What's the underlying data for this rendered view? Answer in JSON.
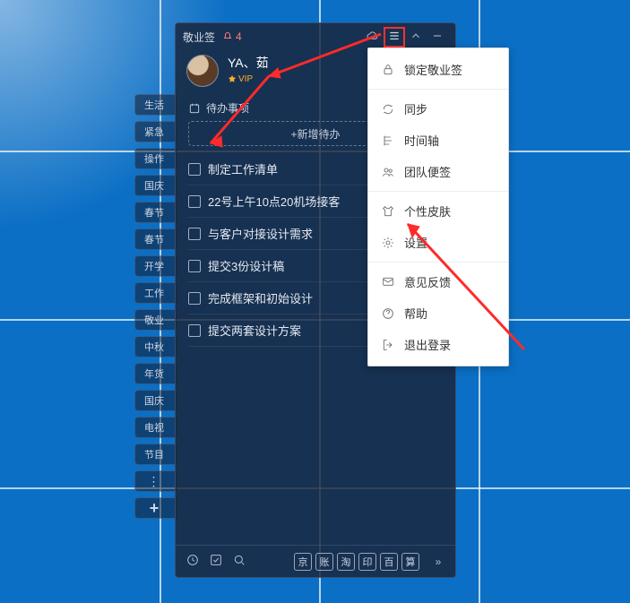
{
  "app_name": "敬业签",
  "notification_count": "4",
  "user": {
    "name": "YA、茹",
    "vip_label": "VIP"
  },
  "section_title": "待办事项",
  "add_button": "+新增待办",
  "todos": [
    "制定工作清单",
    "22号上午10点20机场接客",
    "与客户对接设计需求",
    "提交3份设计稿",
    "完成框架和初始设计",
    "提交两套设计方案"
  ],
  "side_tags": [
    "生活",
    "紧急",
    "操作",
    "国庆",
    "春节",
    "春节",
    "开学",
    "工作",
    "敬业",
    "中秋",
    "年货",
    "国庆",
    "电视",
    "节目"
  ],
  "bottom_chips": [
    "京",
    "账",
    "淘",
    "印",
    "百",
    "算"
  ],
  "menu": {
    "lock": "锁定敬业签",
    "sync": "同步",
    "timeline": "时间轴",
    "team": "团队便签",
    "skin": "个性皮肤",
    "settings": "设置",
    "feedback": "意见反馈",
    "help": "帮助",
    "logout": "退出登录"
  }
}
